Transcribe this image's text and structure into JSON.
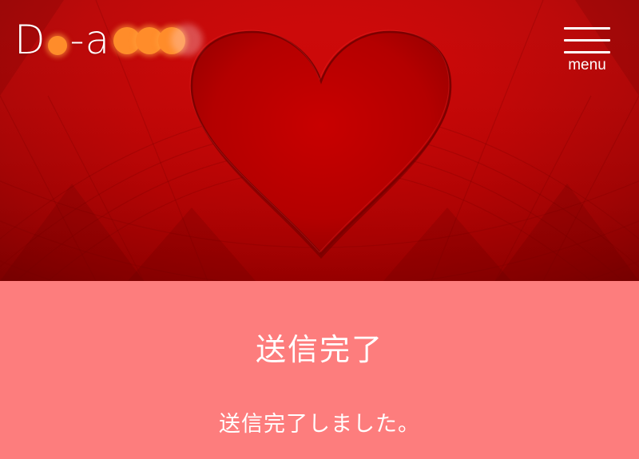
{
  "header": {
    "logo_text_start": "D",
    "logo_text_mid": "-a",
    "menu_label": "menu",
    "menu_icon": "hamburger-menu-icon"
  },
  "hero": {
    "image": "red-heart-background"
  },
  "main": {
    "title": "送信完了",
    "message": "送信完了しました。"
  },
  "colors": {
    "hero_red": "#c00000",
    "content_pink": "#fd7d7d",
    "text_white": "#ffffff",
    "logo_blur_orange": "#ff8c2a"
  }
}
